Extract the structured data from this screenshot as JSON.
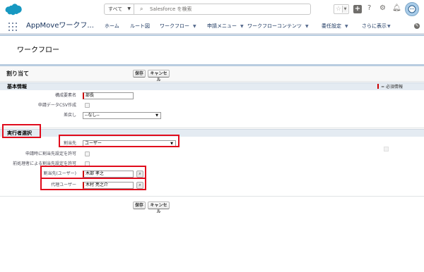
{
  "header": {
    "search_scope": "すべて",
    "search_placeholder": "Salesforce を検索"
  },
  "nav": {
    "app_name": "AppMoveワークフ...",
    "items": [
      {
        "label": "ホーム",
        "has_menu": false
      },
      {
        "label": "ルート図",
        "has_menu": false
      },
      {
        "label": "ワークフロー",
        "has_menu": true
      },
      {
        "label": "申請メニュー",
        "has_menu": true
      },
      {
        "label": "ワークフローコンテンツ",
        "has_menu": true
      },
      {
        "label": "委任設定",
        "has_menu": true
      },
      {
        "label": "さらに表示",
        "has_menu": true
      }
    ]
  },
  "page": {
    "title": "ワークフロー",
    "block_title": "割り当て",
    "save_label": "保存",
    "cancel_label": "キャンセル"
  },
  "basic_info": {
    "section_title": "基本情報",
    "required_legend": "= 必須情報",
    "fields": {
      "member_name_label": "構成要素名",
      "member_name_value": "部長",
      "csv_label": "申請データCSV作成",
      "sendback_label": "差戻し",
      "sendback_value": "--なし--"
    }
  },
  "executor": {
    "section_title": "実行者選択",
    "assignee_label": "割当先",
    "assignee_value": "ユーザー",
    "allow_setting_label": "申請時に割当先設定を許可",
    "allow_prev_label": "前処理者による割当先設定を許可",
    "assignee_user_label": "割当先(ユーザー)",
    "assignee_user_value": "木部 孝之",
    "proxy_user_label": "代理ユーザー",
    "proxy_user_value": "木村 亮之介"
  }
}
